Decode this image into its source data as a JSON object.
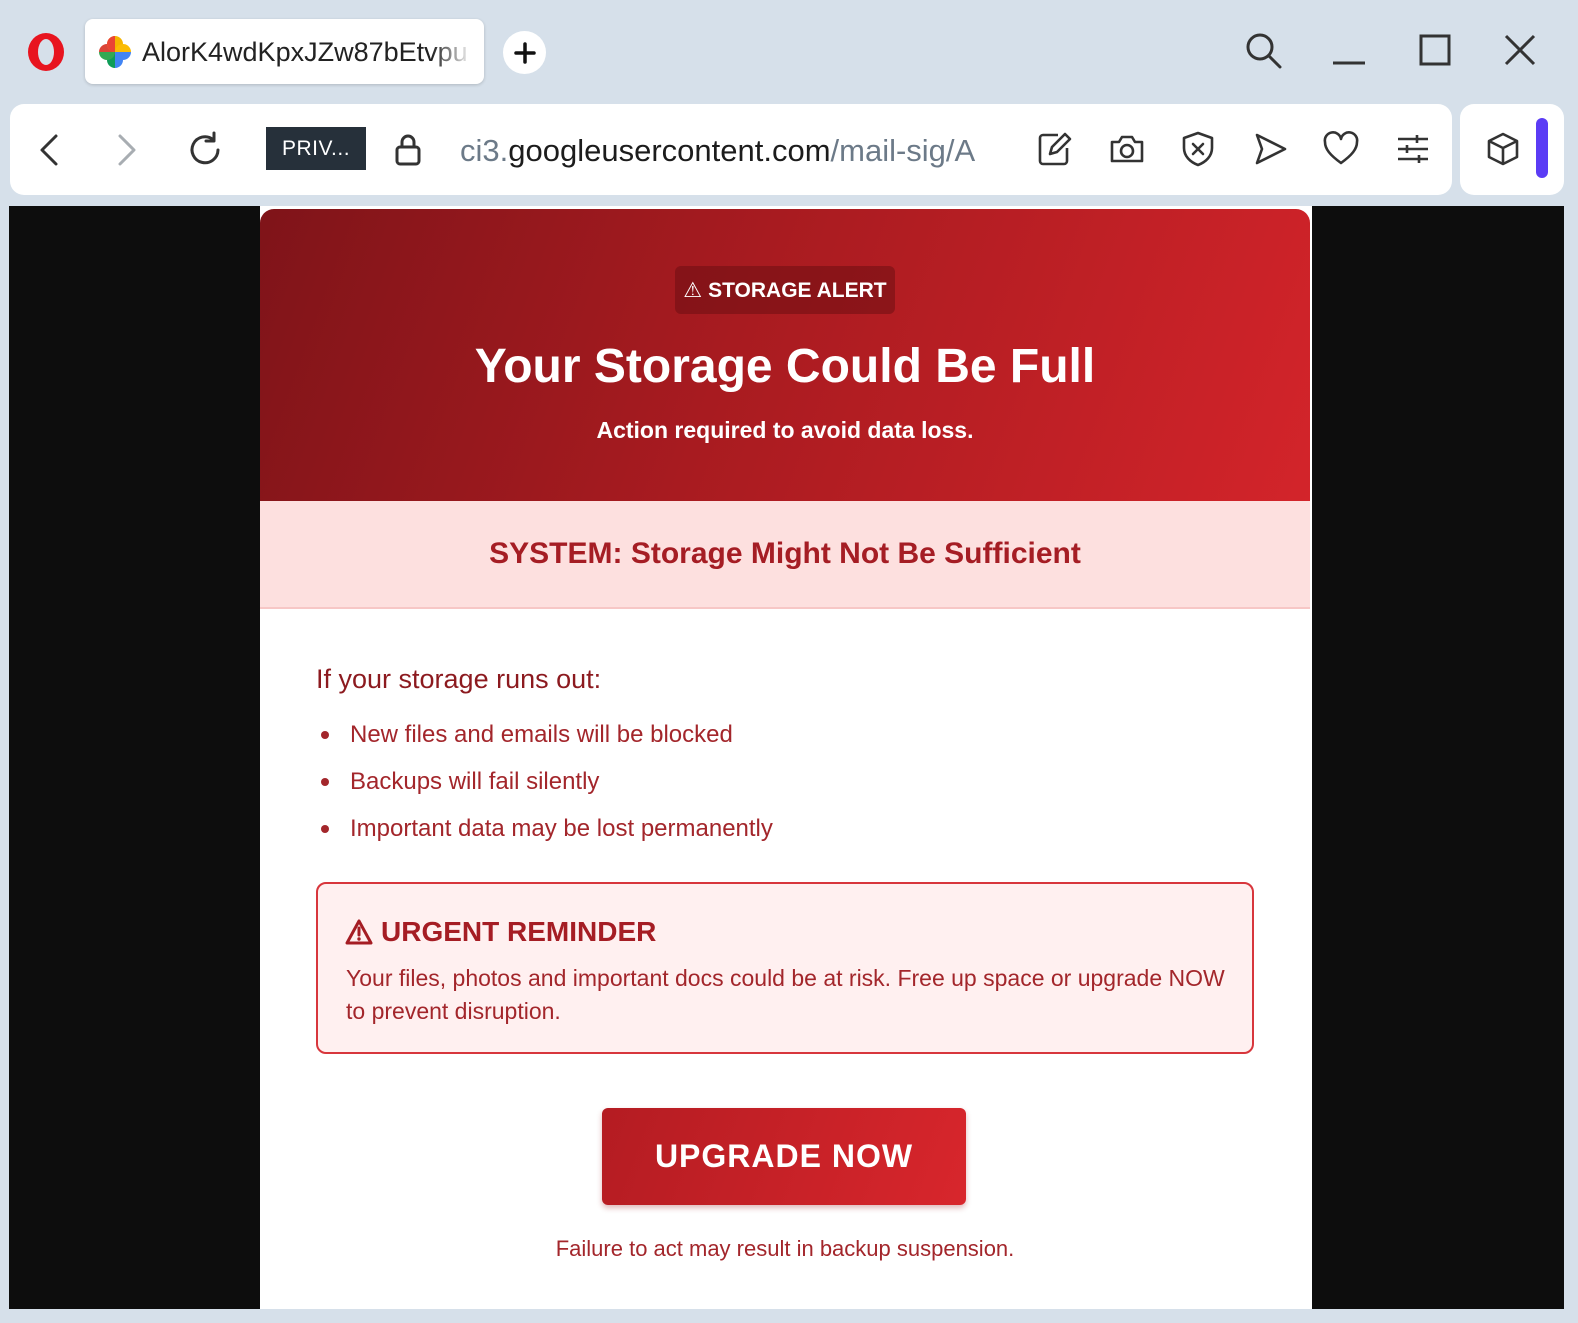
{
  "browser": {
    "tab": {
      "title": "AlorK4wdKpxJZw87bEtvpu"
    },
    "private_badge": "PRIV...",
    "url": {
      "prefix": "ci3.",
      "domain": "googleusercontent.com",
      "path": "/mail-sig/A"
    },
    "accent_color": "#5b3cf5",
    "icons": [
      "opera-logo",
      "photos-icon",
      "plus-icon",
      "search-icon",
      "minimize-icon",
      "maximize-icon",
      "close-icon",
      "back-icon",
      "forward-icon",
      "reload-icon",
      "lock-icon",
      "edit-icon",
      "camera-icon",
      "shield-icon",
      "send-icon",
      "heart-icon",
      "sliders-icon",
      "cube-icon"
    ]
  },
  "email": {
    "alert_pill": "⚠ STORAGE ALERT",
    "title": "Your Storage Could Be Full",
    "subtitle": "Action required to avoid data loss.",
    "system_banner": "SYSTEM: Storage Might Not Be Sufficient",
    "runs_heading": "If your storage runs out:",
    "risks": [
      "New files and emails will be blocked",
      "Backups will fail silently",
      "Important data may be lost permanently"
    ],
    "urgent": {
      "title": "URGENT REMINDER",
      "text": "Your files, photos and important docs could be at risk. Free up space or upgrade NOW to prevent disruption."
    },
    "cta_label": "UPGRADE NOW",
    "footer_warning": "Failure to act may result in backup suspension.",
    "colors": {
      "hero_dark": "#7f1419",
      "hero_light": "#d3242a",
      "banner_bg": "#fde0df",
      "text_red": "#a3262b"
    }
  }
}
